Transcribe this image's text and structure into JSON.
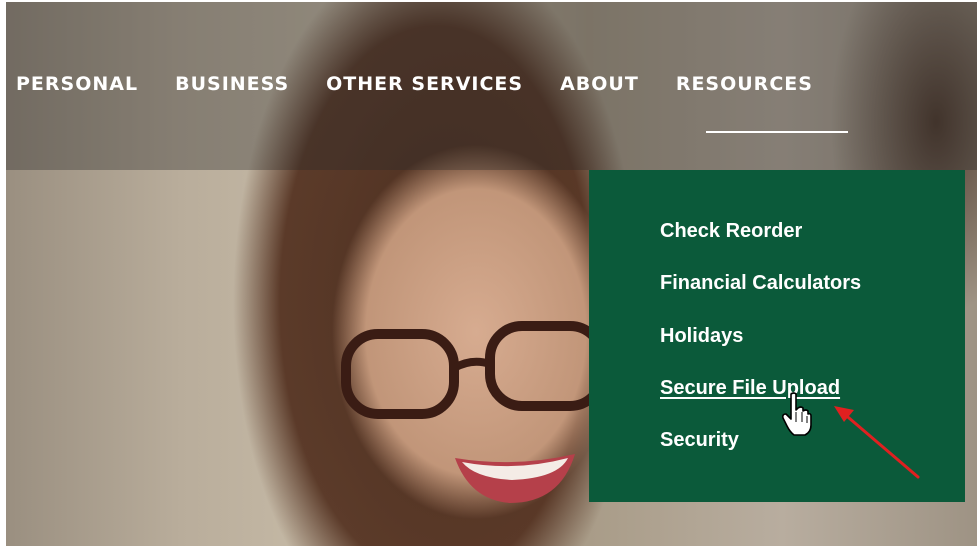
{
  "nav": {
    "items": [
      {
        "label": "PERSONAL"
      },
      {
        "label": "BUSINESS"
      },
      {
        "label": "OTHER SERVICES"
      },
      {
        "label": "ABOUT"
      },
      {
        "label": "RESOURCES"
      }
    ],
    "active": "RESOURCES"
  },
  "dropdown": {
    "items": [
      {
        "label": "Check Reorder"
      },
      {
        "label": "Financial Calculators"
      },
      {
        "label": "Holidays"
      },
      {
        "label": "Secure File Upload"
      },
      {
        "label": "Security"
      }
    ],
    "hovered": "Secure File Upload",
    "background_color": "#0b5a3a"
  },
  "icons": {
    "cursor": "hand-pointer-icon",
    "annotation": "red-arrow-icon"
  },
  "colors": {
    "nav_text": "#ffffff",
    "annotation_arrow": "#e02020"
  }
}
